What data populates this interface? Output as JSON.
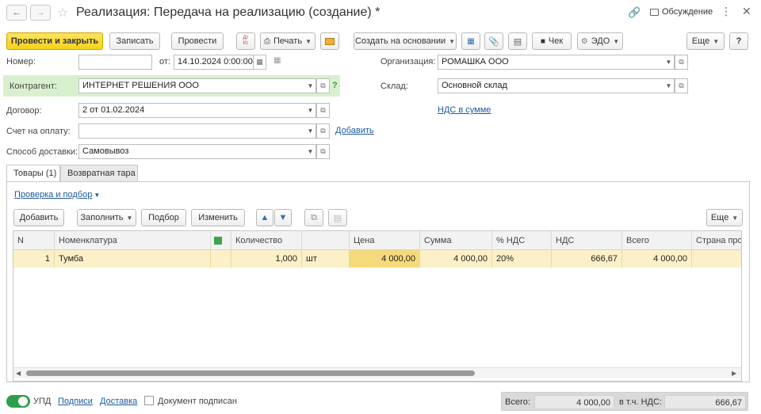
{
  "window": {
    "title": "Реализация: Передача на реализацию (создание) *",
    "discussion_label": "Обсуждение"
  },
  "toolbar": {
    "post_close": "Провести и закрыть",
    "save": "Записать",
    "post": "Провести",
    "dt_kt": "Дт Кт",
    "print": "Печать",
    "create_basis": "Создать на основании",
    "receipt": "Чек",
    "edo": "ЭДО",
    "more": "Еще",
    "help": "?"
  },
  "form": {
    "number_label": "Номер:",
    "number_value": "",
    "from_label": "от:",
    "date_value": "14.10.2024  0:00:00",
    "org_label": "Организация:",
    "org_value": "РОМАШКА ООО",
    "counterparty_label": "Контрагент:",
    "counterparty_value": "ИНТЕРНЕТ РЕШЕНИЯ ООО",
    "counterparty_hint": "?",
    "warehouse_label": "Склад:",
    "warehouse_value": "Основной склад",
    "contract_label": "Договор:",
    "contract_value": "2 от 01.02.2024",
    "vat_link": "НДС в сумме",
    "invoice_label": "Счет на оплату:",
    "invoice_value": "",
    "invoice_add": "Добавить",
    "delivery_label": "Способ доставки:",
    "delivery_value": "Самовывоз"
  },
  "tabs": [
    {
      "label": "Товары (1)"
    },
    {
      "label": "Возвратная тара"
    }
  ],
  "goods": {
    "check_link": "Проверка и подбор",
    "add": "Добавить",
    "fill": "Заполнить",
    "pick": "Подбор",
    "change": "Изменить",
    "more": "Еще",
    "columns": [
      "N",
      "Номенклатура",
      "",
      "Количество",
      "",
      "Цена",
      "Сумма",
      "% НДС",
      "НДС",
      "Всего",
      "Страна про"
    ],
    "rows": [
      {
        "n": "1",
        "name": "Тумба",
        "mark": "",
        "qty": "1,000",
        "unit": "шт",
        "price": "4 000,00",
        "sum": "4 000,00",
        "vat_rate": "20%",
        "vat": "666,67",
        "total": "4 000,00",
        "country": ""
      }
    ]
  },
  "footer": {
    "upd_label": "УПД",
    "signatures": "Подписи",
    "delivery": "Доставка",
    "doc_signed": "Документ подписан",
    "total_label": "Всего:",
    "total_value": "4 000,00",
    "vat_incl_label": "в т.ч. НДС:",
    "vat_incl_value": "666,67"
  }
}
